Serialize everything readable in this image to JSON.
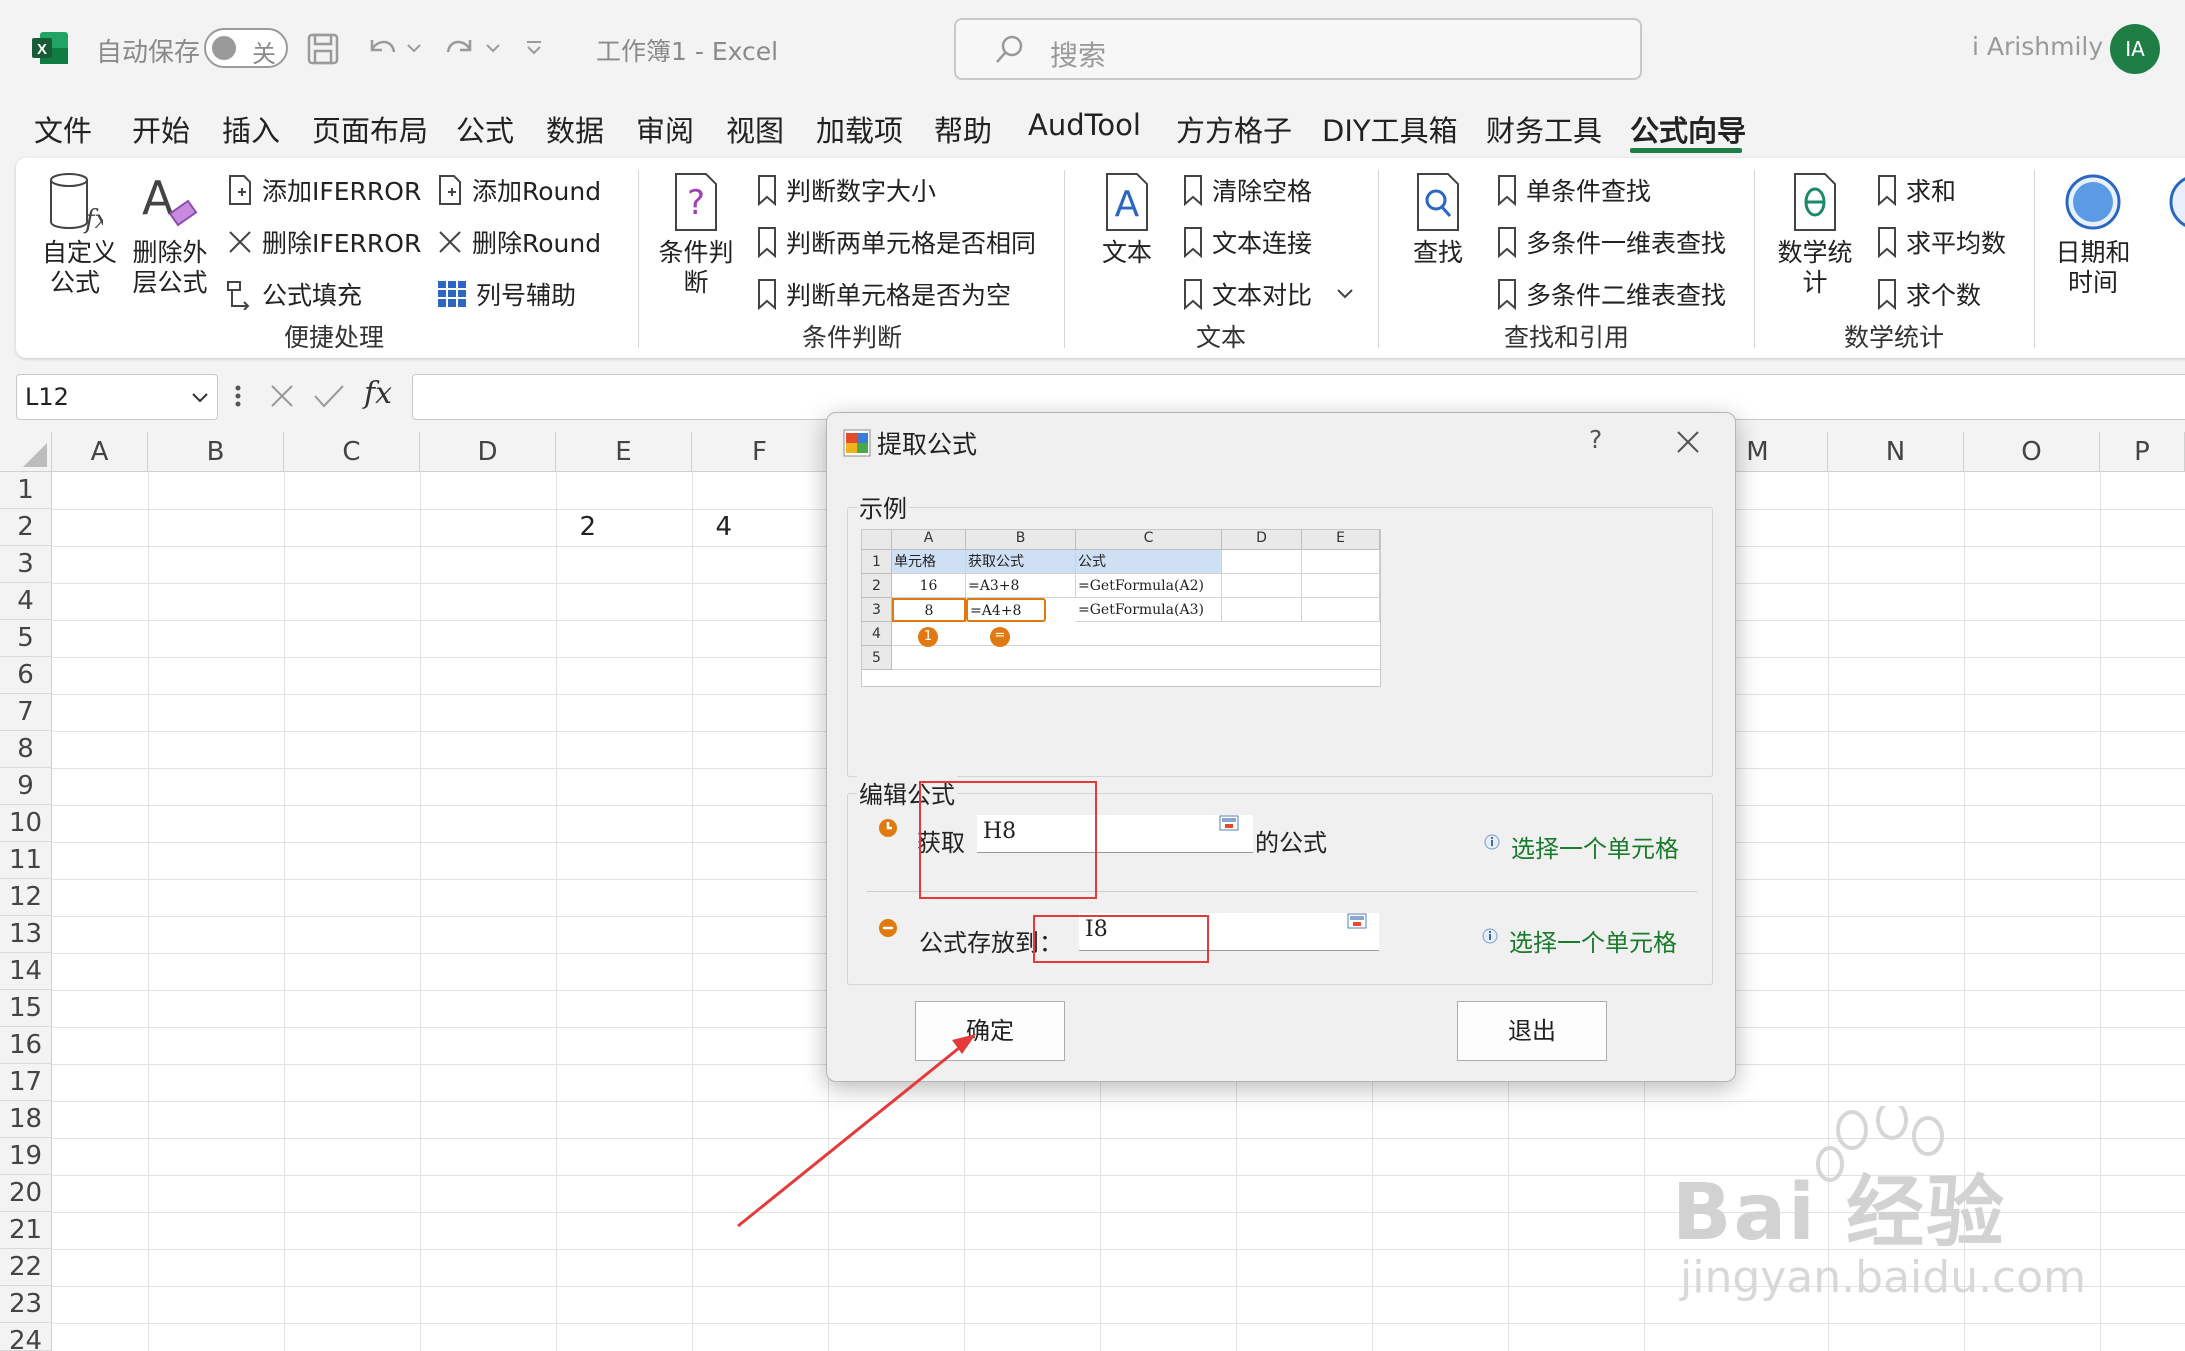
{
  "titlebar": {
    "autosave_label": "自动保存",
    "autosave_state": "关",
    "doc_title": "工作簿1  -  Excel",
    "search_placeholder": "搜索",
    "user_name": "i Arishmily",
    "user_initials": "IA"
  },
  "menu": {
    "tabs": [
      "文件",
      "开始",
      "插入",
      "页面布局",
      "公式",
      "数据",
      "审阅",
      "视图",
      "加载项",
      "帮助",
      "AudTool",
      "方方格子",
      "DIY工具箱",
      "财务工具",
      "公式向导"
    ],
    "active_tab": "公式向导"
  },
  "ribbon": {
    "groups": [
      {
        "label": "便捷处理",
        "big_buttons": [
          "自定义\n公式",
          "删除外\n层公式"
        ],
        "items": [
          "添加IFERROR",
          "删除IFERROR",
          "公式填充",
          "添加Round",
          "删除Round",
          "列号辅助"
        ]
      },
      {
        "label": "条件判断",
        "big_buttons": [
          "条件判\n断"
        ],
        "items": [
          "判断数字大小",
          "判断两单元格是否相同",
          "判断单元格是否为空"
        ]
      },
      {
        "label": "文本",
        "big_buttons": [
          "文本"
        ],
        "items": [
          "清除空格",
          "文本连接",
          "文本对比"
        ]
      },
      {
        "label": "查找和引用",
        "big_buttons": [
          "查找"
        ],
        "items": [
          "单条件查找",
          "多条件一维表查找",
          "多条件二维表查找"
        ]
      },
      {
        "label": "数学统计",
        "big_buttons": [
          "数学统\n计"
        ],
        "items": [
          "求和",
          "求平均数",
          "求个数"
        ]
      },
      {
        "label": "",
        "big_buttons": [
          "日期和\n时间"
        ],
        "items": []
      }
    ]
  },
  "formula_bar": {
    "name_box": "L12",
    "fx": "fx",
    "formula": ""
  },
  "sheet": {
    "columns": [
      "A",
      "B",
      "C",
      "D",
      "E",
      "F",
      "M",
      "N",
      "O",
      "P"
    ],
    "rows": [
      "1",
      "2",
      "3",
      "4",
      "5",
      "6",
      "7",
      "8",
      "9",
      "10",
      "11",
      "12",
      "13",
      "14",
      "15",
      "16",
      "17",
      "18",
      "19",
      "20",
      "21",
      "22",
      "23",
      "24"
    ],
    "cells": [
      {
        "ref": "D2",
        "value": "2"
      },
      {
        "ref": "E2",
        "value": "4"
      }
    ]
  },
  "dialog": {
    "title": "提取公式",
    "help": "?",
    "example_title": "示例",
    "example": {
      "columns": [
        "A",
        "B",
        "C",
        "D",
        "E"
      ],
      "rows": [
        "1",
        "2",
        "3",
        "4",
        "5"
      ],
      "cells": [
        [
          "单元格",
          "获取公式",
          "公式"
        ],
        [
          "16",
          "=A3+8",
          "=GetFormula(A2)"
        ],
        [
          "8",
          "=A4+8",
          "=GetFormula(A3)"
        ]
      ],
      "markers": [
        "1",
        "="
      ]
    },
    "edit_title": "编辑公式",
    "get_label": "获取",
    "get_value": "H8",
    "get_suffix": "的公式",
    "store_label": "公式存放到：",
    "store_value": "I8",
    "select_cell_link": "选择一个单元格",
    "ok_button": "确定",
    "exit_button": "退出"
  },
  "watermark": {
    "brand": "Bai 经验",
    "url": "jingyan.baidu.com"
  },
  "colors": {
    "excel_green": "#1e7e45",
    "annotation_red": "#e43a3a",
    "link_green": "#1a7a2c",
    "highlight_orange": "#e07a10"
  }
}
